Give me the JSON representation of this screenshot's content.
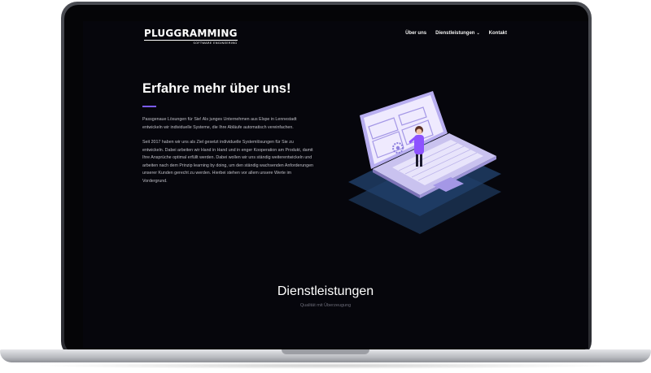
{
  "header": {
    "logo_text": "PLUGGRAMMING",
    "logo_subtitle": "SOFTWARE ENGINEERING",
    "nav": [
      {
        "label": "Über uns"
      },
      {
        "label": "Dienstleistungen"
      },
      {
        "label": "Kontakt"
      }
    ]
  },
  "about": {
    "title": "Erfahre mehr über uns!",
    "paragraph1": "Passgenaue Lösungen für Sie! Als junges Unternehmen aus Elspe in Lennestadt entwickeln wir individuelle Systeme, die Ihre Abläufe automatisch vereinfachen.",
    "paragraph2": "Seit 2017 haben wir uns als Ziel gesetzt individuelle Systemlösungen für Sie zu entwickeln. Dabei arbeiten wir Hand in Hand und in enger Kooperation am Produkt, damit Ihre Ansprüche optimal erfüllt werden. Dabei wollen wir uns ständig weiterentwickeln und arbeiten nach dem Prinzip learning by doing, um den ständig wachsenden Anforderungen unserer Kunden gerecht zu werden. Hierbei stehen vor allem unsere Werte im Vordergrund."
  },
  "services": {
    "title": "Dienstleistungen",
    "subtitle": "Qualität mit Überzeugung"
  },
  "colors": {
    "page_background": "#06060c",
    "accent": "#7b5cff",
    "text_body": "#bfbfc7"
  },
  "icons": {
    "dropdown": "chevron-down-icon",
    "illustration": "laptop-illustration"
  }
}
